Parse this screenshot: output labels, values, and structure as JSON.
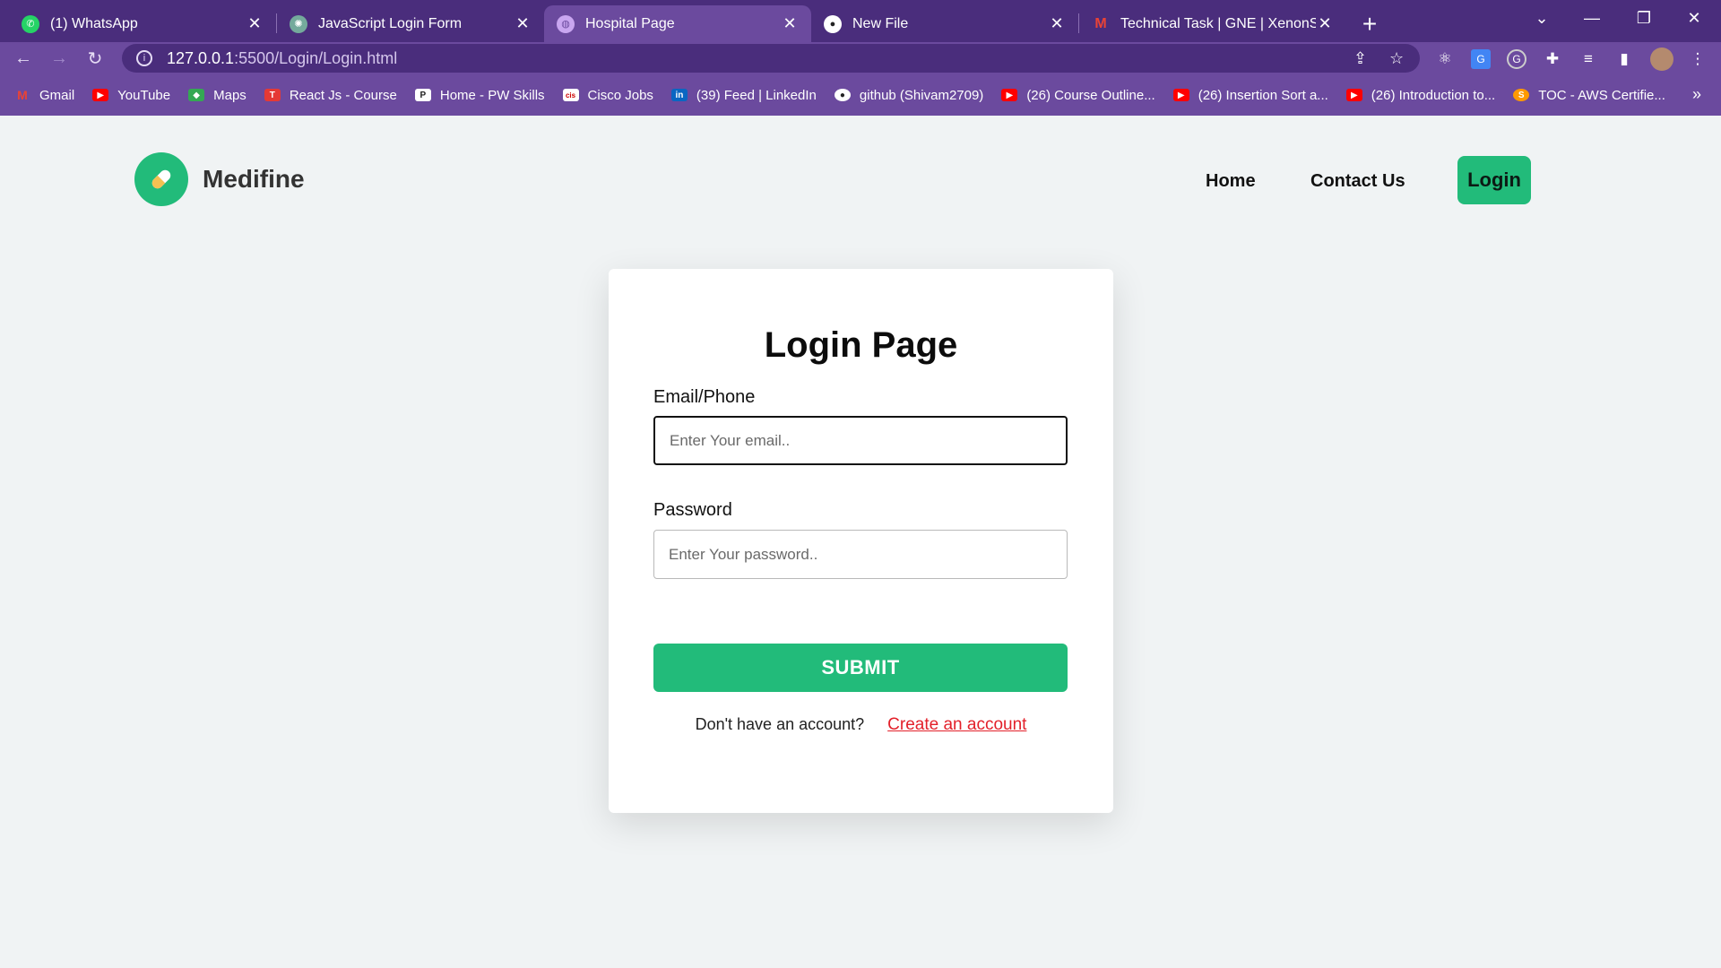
{
  "browser": {
    "tabs": [
      {
        "title": "(1) WhatsApp",
        "icon": "whatsapp-icon",
        "color": "#25d366",
        "active": false
      },
      {
        "title": "JavaScript Login Form",
        "icon": "chatgpt-icon",
        "color": "#74aa9c",
        "active": false
      },
      {
        "title": "Hospital Page",
        "icon": "globe-icon",
        "color": "#c9a6f0",
        "active": true
      },
      {
        "title": "New File",
        "icon": "github-icon",
        "color": "#ffffff",
        "active": false
      },
      {
        "title": "Technical Task | GNE | XenonStack",
        "icon": "gmail-icon",
        "color": "#ea4335",
        "active": false
      }
    ],
    "url_host": "127.0.0.1",
    "url_path": ":5500/Login/Login.html",
    "bookmarks": [
      {
        "label": "Gmail",
        "icon": "gmail-icon",
        "color": "#ea4335"
      },
      {
        "label": "YouTube",
        "icon": "youtube-icon",
        "color": "#ff0000"
      },
      {
        "label": "Maps",
        "icon": "maps-icon",
        "color": "#34a853"
      },
      {
        "label": "React Js - Course",
        "icon": "t-icon",
        "color": "#e53935"
      },
      {
        "label": "Home - PW Skills",
        "icon": "pw-icon",
        "color": "#222222"
      },
      {
        "label": "Cisco Jobs",
        "icon": "cisco-icon",
        "color": "#ffffff"
      },
      {
        "label": "(39) Feed | LinkedIn",
        "icon": "linkedin-icon",
        "color": "#0a66c2"
      },
      {
        "label": "github (Shivam2709)",
        "icon": "github-icon",
        "color": "#222222"
      },
      {
        "label": "(26) Course Outline...",
        "icon": "youtube-icon",
        "color": "#ff0000"
      },
      {
        "label": "(26) Insertion Sort a...",
        "icon": "youtube-icon",
        "color": "#ff0000"
      },
      {
        "label": "(26) Introduction to...",
        "icon": "youtube-icon",
        "color": "#ff0000"
      },
      {
        "label": "TOC - AWS Certifie...",
        "icon": "aws-icon",
        "color": "#ff9900"
      }
    ]
  },
  "site": {
    "brand": "Medifine",
    "nav_home": "Home",
    "nav_contact": "Contact Us",
    "nav_login": "Login",
    "accent": "#22bb7a"
  },
  "form": {
    "title": "Login Page",
    "email_label": "Email/Phone",
    "email_placeholder": "Enter Your email..",
    "password_label": "Password",
    "password_placeholder": "Enter Your password..",
    "submit_label": "SUBMIT",
    "signup_text": "Don't have an account?",
    "signup_link": "Create an account",
    "link_color": "#e3202a"
  }
}
